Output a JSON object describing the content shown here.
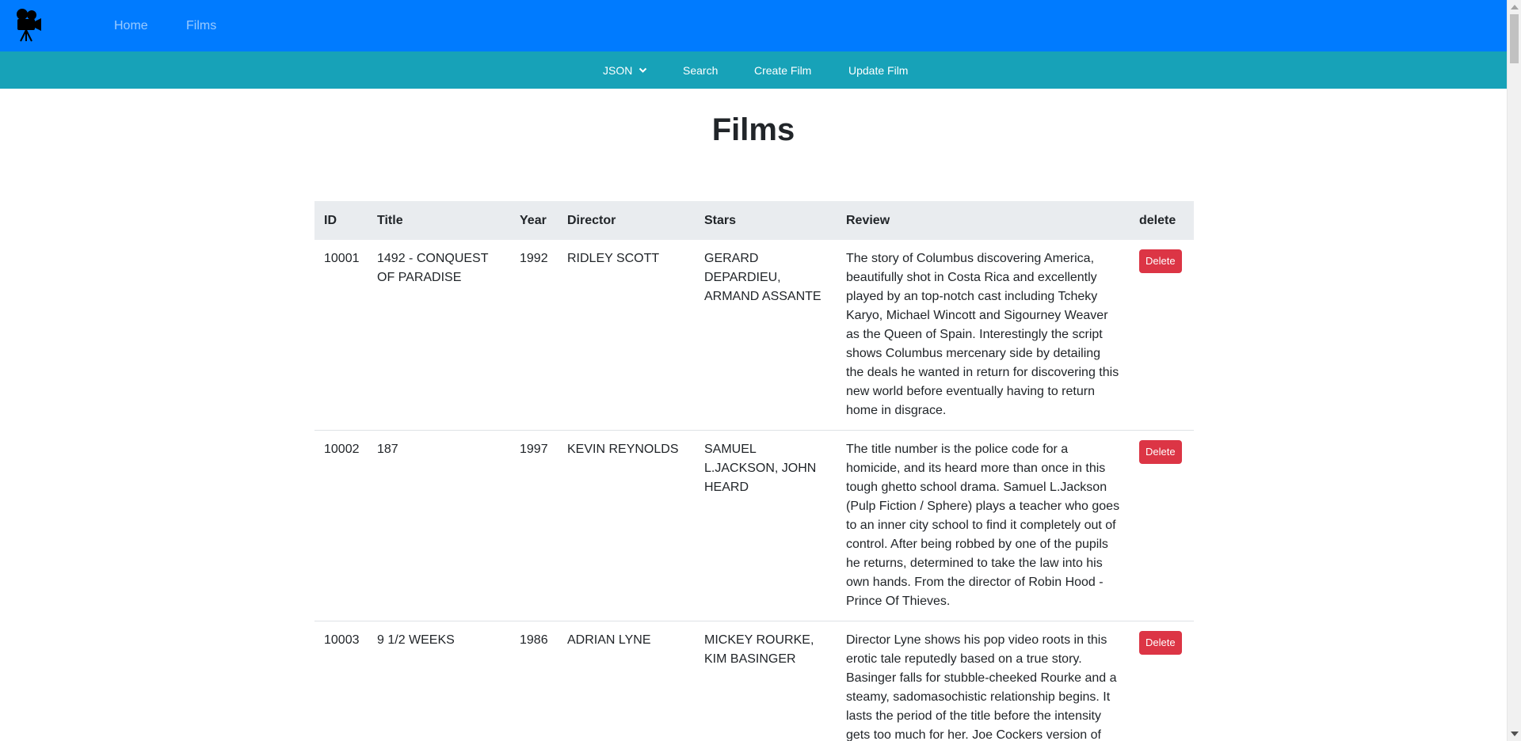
{
  "topnav": {
    "logo_icon": "movie-camera-icon",
    "links": [
      {
        "label": "Home"
      },
      {
        "label": "Films"
      }
    ],
    "bg_color": "#007bff"
  },
  "subnav": {
    "bg_color": "#17a2b8",
    "format_dropdown": {
      "label": "JSON",
      "icon": "chevron-down-icon"
    },
    "items": [
      {
        "label": "Search"
      },
      {
        "label": "Create Film"
      },
      {
        "label": "Update Film"
      }
    ]
  },
  "main": {
    "title": "Films",
    "table": {
      "headers": [
        "ID",
        "Title",
        "Year",
        "Director",
        "Stars",
        "Review",
        "delete"
      ],
      "rows": [
        {
          "id": "10001",
          "title": "1492 - CONQUEST OF PARADISE",
          "year": "1992",
          "director": "RIDLEY SCOTT",
          "stars": "GERARD DEPARDIEU, ARMAND ASSANTE",
          "review": "The story of Columbus discovering America, beautifully shot in Costa Rica and excellently played by an top-notch cast including Tcheky Karyo, Michael Wincott and Sigourney Weaver as the Queen of Spain. Interestingly the script shows Columbus mercenary side by detailing the deals he wanted in return for discovering this new world before eventually having to return home in disgrace.",
          "delete_label": "Delete"
        },
        {
          "id": "10002",
          "title": "187",
          "year": "1997",
          "director": "KEVIN REYNOLDS",
          "stars": "SAMUEL L.JACKSON, JOHN HEARD",
          "review": "The title number is the police code for a homicide, and its heard more than once in this tough ghetto school drama. Samuel L.Jackson (Pulp Fiction / Sphere) plays a teacher who goes to an inner city school to find it completely out of control. After being robbed by one of the pupils he returns, determined to take the law into his own hands. From the director of Robin Hood - Prince Of Thieves.",
          "delete_label": "Delete"
        },
        {
          "id": "10003",
          "title": "9 1/2 WEEKS",
          "year": "1986",
          "director": "ADRIAN LYNE",
          "stars": "MICKEY ROURKE, KIM BASINGER",
          "review": "Director Lyne shows his pop video roots in this erotic tale reputedly based on a true story. Basinger falls for stubble-cheeked Rourke and a steamy, sadomasochistic relationship begins. It lasts the period of the title before the intensity gets too much for her. Joe Cockers version of",
          "delete_label": "Delete"
        }
      ]
    },
    "delete_color": "#dc3545"
  }
}
